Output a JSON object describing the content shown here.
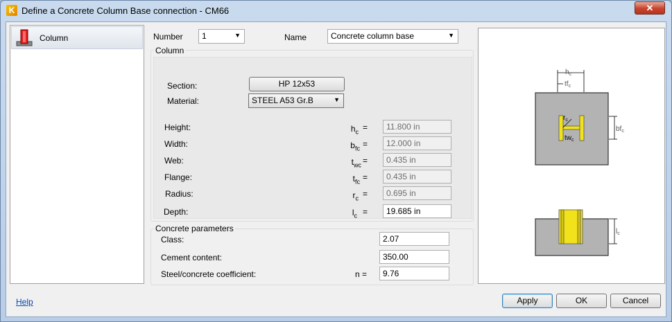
{
  "window": {
    "title": "Define a Concrete Column Base connection - CM66",
    "app_icon_letter": "K",
    "close_glyph": "✕"
  },
  "left_panel": {
    "items": [
      {
        "label": "Column"
      }
    ]
  },
  "header": {
    "number_label": "Number",
    "number_value": "1",
    "name_label": "Name",
    "name_value": "Concrete column base"
  },
  "column": {
    "group_title": "Column",
    "section_label": "Section:",
    "section_value": "HP 12x53",
    "material_label": "Material:",
    "material_value": "STEEL A53 Gr.B",
    "props": [
      {
        "label": "Height:",
        "sym": "h",
        "sub": "c",
        "value": "11.800 in"
      },
      {
        "label": "Width:",
        "sym": "b",
        "sub": "fc",
        "value": "12.000 in"
      },
      {
        "label": "Web:",
        "sym": "t",
        "sub": "wc",
        "value": "0.435 in"
      },
      {
        "label": "Flange:",
        "sym": "t",
        "sub": "fc",
        "value": "0.435 in"
      },
      {
        "label": "Radius:",
        "sym": "r",
        "sub": "c",
        "value": "0.695 in"
      }
    ],
    "depth": {
      "label": "Depth:",
      "sym": "l",
      "sub": "c",
      "value": "19.685 in"
    },
    "eq": "="
  },
  "concrete": {
    "group_title": "Concrete parameters",
    "class_label": "Class:",
    "class_value": "2.07",
    "cement_label": "Cement content:",
    "cement_value": "350.00",
    "coef_label": "Steel/concrete coefficient:",
    "coef_sym": "n =",
    "coef_value": "9.76"
  },
  "diagram": {
    "hc": "h",
    "hc_sub": "c",
    "tfc": "tf",
    "tfc_sub": "c",
    "bfc": "bf",
    "bfc_sub": "c",
    "rc": "r",
    "rc_sub": "c",
    "twc": "tw",
    "twc_sub": "c",
    "lc": "l",
    "lc_sub": "c"
  },
  "footer": {
    "help": "Help",
    "apply": "Apply",
    "ok": "OK",
    "cancel": "Cancel"
  }
}
